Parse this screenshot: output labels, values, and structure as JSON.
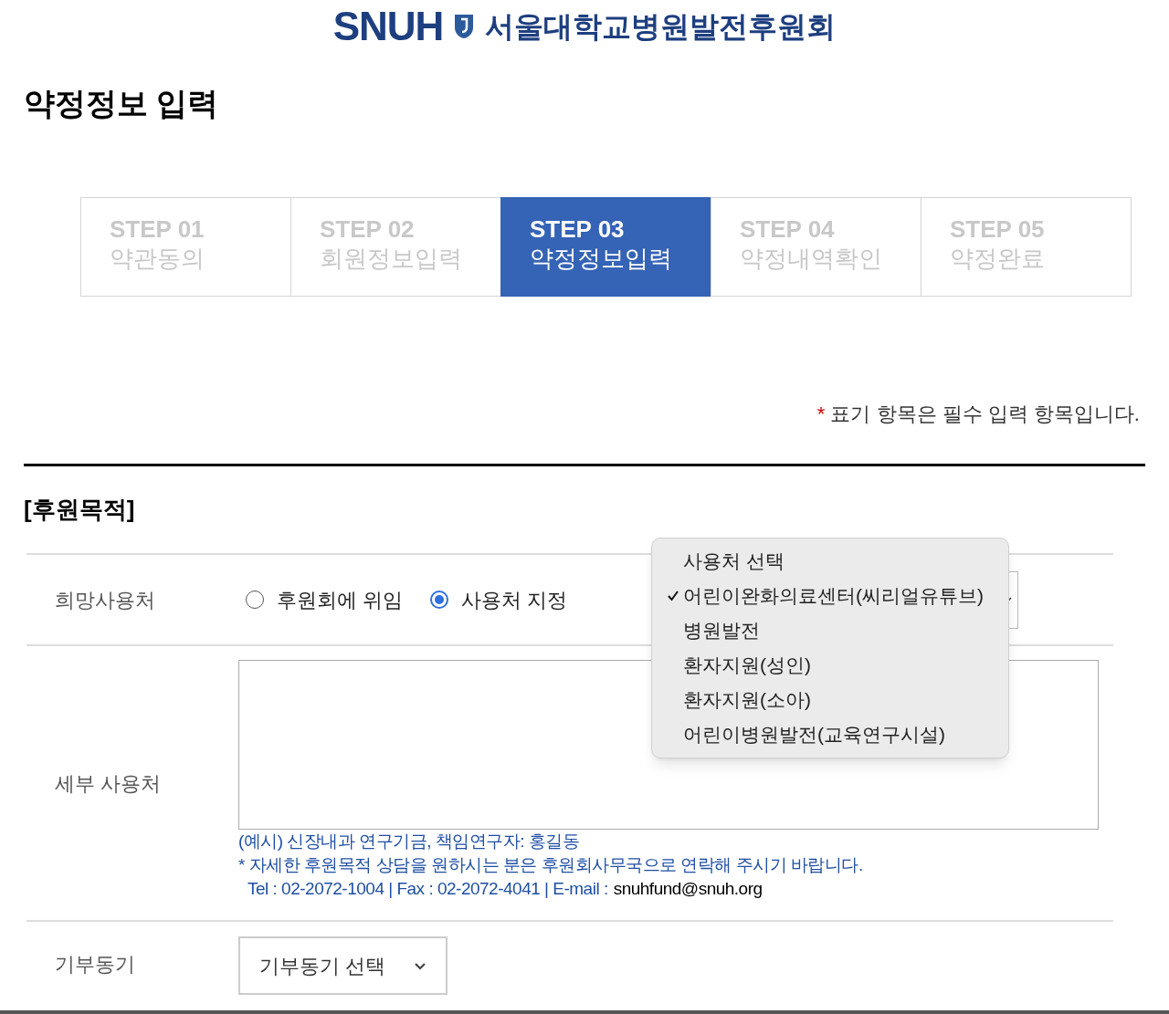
{
  "logo": {
    "mark": "SNUH",
    "name": "서울대학교병원발전후원회"
  },
  "page_title": "약정정보 입력",
  "steps": [
    {
      "number": "STEP 01",
      "label": "약관동의",
      "selected": false
    },
    {
      "number": "STEP 02",
      "label": "회원정보입력",
      "selected": false
    },
    {
      "number": "STEP 03",
      "label": "약정정보입력",
      "selected": true
    },
    {
      "number": "STEP 04",
      "label": "약정내역확인",
      "selected": false
    },
    {
      "number": "STEP 05",
      "label": "약정완료",
      "selected": false
    }
  ],
  "required_note": {
    "mark": "*",
    "text": "표기 항목은 필수 입력 항목입니다."
  },
  "section_title": "[후원목적]",
  "usage": {
    "label": "희망사용처",
    "options": [
      {
        "label": "후원회에 위임",
        "selected": false
      },
      {
        "label": "사용처 지정",
        "selected": true
      }
    ]
  },
  "usage_menu": [
    {
      "label": "사용처 선택",
      "checked": false
    },
    {
      "label": "어린이완화의료센터(씨리얼유튜브)",
      "checked": true
    },
    {
      "label": "병원발전",
      "checked": false
    },
    {
      "label": "환자지원(성인)",
      "checked": false
    },
    {
      "label": "환자지원(소아)",
      "checked": false
    },
    {
      "label": "어린이병원발전(교육연구시설)",
      "checked": false
    }
  ],
  "detail": {
    "label": "세부 사용처",
    "example": "(예시) 신장내과 연구기금, 책임연구자: 홍길동",
    "notice": "* 자세한 후원목적 상담을 원하시는 분은 후원회사무국으로 연락해 주시기 바랍니다.",
    "contact": "Tel : 02-2072-1004 | Fax : 02-2072-4041 | E-mail :",
    "email": "snuhfund@snuh.org"
  },
  "motive": {
    "label": "기부동기",
    "value": "기부동기 선택"
  }
}
